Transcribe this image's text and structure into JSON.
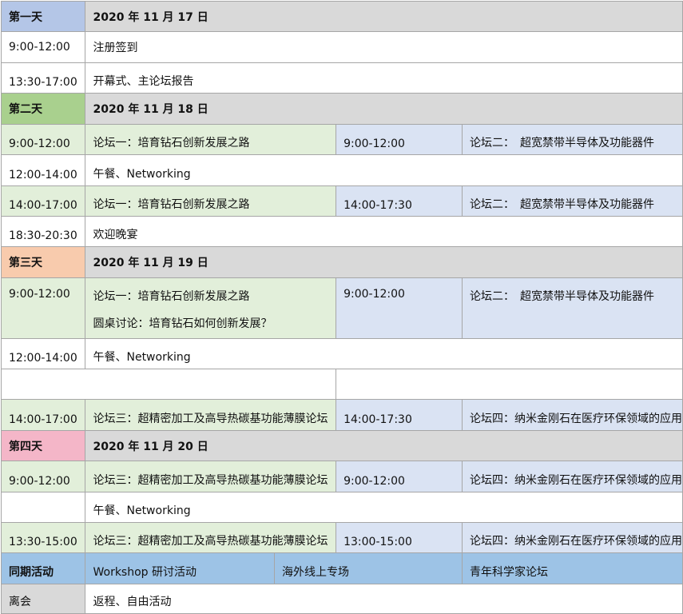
{
  "days": [
    {
      "label": "第一天",
      "date": "2020 年 11 月 17 日",
      "color": "#b4c6e7",
      "sessions": [
        {
          "time": "9:00-12:00",
          "event": "注册签到"
        },
        {
          "time": "13:30-17:00",
          "event": "开幕式、主论坛报告"
        }
      ]
    },
    {
      "label": "第二天",
      "date": "2020 年 11 月 18 日",
      "color": "#a9d08e",
      "sessions": [
        {
          "time": "9:00-12:00",
          "event": "论坛一：培育钻石创新发展之路",
          "time2": "9:00-12:00",
          "event2": "论坛二：　超宽禁带半导体及功能器件"
        },
        {
          "time": "12:00-14:00",
          "event": "午餐、Networking"
        },
        {
          "time": "14:00-17:00",
          "event": "论坛一：培育钻石创新发展之路",
          "time2": "14:00-17:30",
          "event2": "论坛二：　超宽禁带半导体及功能器件"
        },
        {
          "time": "18:30-20:30",
          "event": "欢迎晚宴"
        }
      ]
    },
    {
      "label": "第三天",
      "date": "2020 年 11 月 19 日",
      "color": "#f8cbad",
      "sessions": [
        {
          "time": "9:00-12:00",
          "event": "论坛一：培育钻石创新发展之路",
          "event_extra": "圆桌讨论：培育钻石如何创新发展？",
          "time2": "9:00-12:00",
          "event2": "论坛二：　超宽禁带半导体及功能器件"
        },
        {
          "time": "12:00-14:00",
          "event": "午餐、Networking"
        },
        {
          "time": "14:00-17:00",
          "event": "论坛三：超精密加工及高导热碳基功能薄膜论坛",
          "time2": "14:00-17:30",
          "event2": "论坛四：纳米金刚石在医疗环保领域的应用"
        }
      ]
    },
    {
      "label": "第四天",
      "date": "2020 年 11 月 20 日",
      "color": "#f4b6c8",
      "sessions": [
        {
          "time": "9:00-12:00",
          "event": "论坛三：超精密加工及高导热碳基功能薄膜论坛",
          "time2": "9:00-12:00",
          "event2": "论坛四：纳米金刚石在医疗环保领域的应用"
        },
        {
          "time": "",
          "event": "午餐、Networking"
        },
        {
          "time": "13:30-15:00",
          "event": "论坛三：超精密加工及高导热碳基功能薄膜论坛",
          "time2": "13:00-15:00",
          "event2": "论坛四：纳米金刚石在医疗环保领域的应用"
        }
      ]
    }
  ],
  "concurrent": {
    "label": "同期活动",
    "items": [
      "Workshop 研讨活动",
      "海外线上专场",
      "青年科学家论坛"
    ],
    "color": "#9dc3e6"
  },
  "departure": {
    "label": "离会",
    "event": "返程、自由活动"
  }
}
